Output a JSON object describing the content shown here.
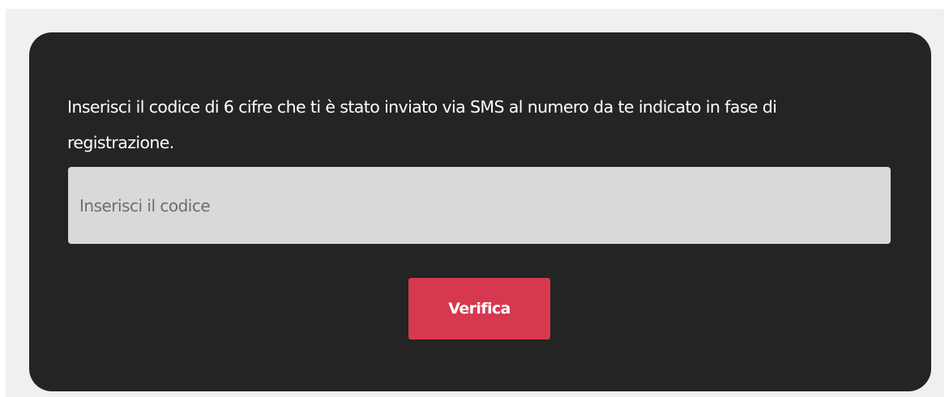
{
  "verification": {
    "instructions": "Inserisci il codice di 6 cifre che ti è stato inviato via SMS al numero da te indicato in fase di registrazione.",
    "code_placeholder": "Inserisci il codice",
    "code_value": "",
    "verify_label": "Verifica"
  },
  "colors": {
    "page_background": "#f0f0f0",
    "card_background": "#242424",
    "input_background": "#d9d9d9",
    "accent": "#d6384f"
  }
}
